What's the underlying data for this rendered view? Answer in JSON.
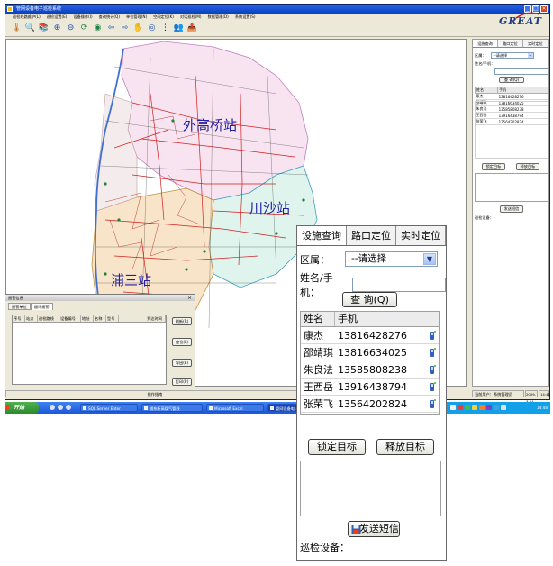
{
  "window": {
    "title": "管网设备电子巡检系统",
    "menu": [
      "巡检线路维护(L)",
      "巡检设置(E)",
      "设备操作(I)",
      "查询统计(Q)",
      "单位管理(N)",
      "空间定位(K)",
      "对话巡检(M)",
      "数据管理(D)",
      "系统设置(S)"
    ]
  },
  "toolbar": {
    "icons": [
      "thermometer-icon",
      "zoom-window-icon",
      "library-icon",
      "zoom-in-icon",
      "zoom-out-icon",
      "refresh-icon",
      "globe-icon",
      "back-icon",
      "forward-icon",
      "pan-icon",
      "locate-icon",
      "separator-icon",
      "users-icon",
      "export-icon"
    ],
    "glyphs": [
      "🌡",
      "🔍",
      "📚",
      "⊕",
      "⊖",
      "⟳",
      "◉",
      "⇦",
      "⇨",
      "✋",
      "◎",
      "⋮",
      "👥",
      "📤"
    ],
    "logo": "GREAT"
  },
  "map": {
    "stations": {
      "north": "外高桥站",
      "east": "川沙站",
      "south": "浦三站"
    }
  },
  "panel": {
    "tabs": [
      "设施查询",
      "路口定位",
      "实时定位"
    ],
    "district_label": "区属：",
    "district_value": "--请选择",
    "name_label": "姓名/手机：",
    "query_button": "查 询(Q)",
    "table_headers": [
      "姓名",
      "手机"
    ],
    "rows": [
      {
        "name": "康杰",
        "phone": "13816428276"
      },
      {
        "name": "邵靖琪",
        "phone": "13816634025"
      },
      {
        "name": "朱良法",
        "phone": "13585808238"
      },
      {
        "name": "王西岳",
        "phone": "13916438794"
      },
      {
        "name": "张荣飞",
        "phone": "13564202824"
      }
    ],
    "lock_button": "锁定目标",
    "release_button": "释放目标",
    "send_sms_button": "发送短信",
    "device_label": "巡检设备："
  },
  "alarm": {
    "title": "报警信息",
    "tabs": [
      "报警单位",
      "通讯报警"
    ],
    "columns": [
      "序号",
      "站点",
      "巡检路线",
      "设备编号",
      "地址",
      "名称",
      "型号",
      "到达时间"
    ],
    "buttons": [
      "刷新(R)",
      "定位(L)",
      "导出(E)",
      "打印(P)"
    ]
  },
  "statusbar": {
    "center": "操作指南",
    "user": "当前用户：系统管理员",
    "date": "2009-3-24",
    "time": "14:48"
  },
  "taskbar": {
    "start": "开始",
    "tasks": [
      "SQL Server Enter",
      "浦东新高煤气管线",
      "Microsoft Excel",
      "管网设备电..."
    ],
    "clock": "14:48"
  }
}
